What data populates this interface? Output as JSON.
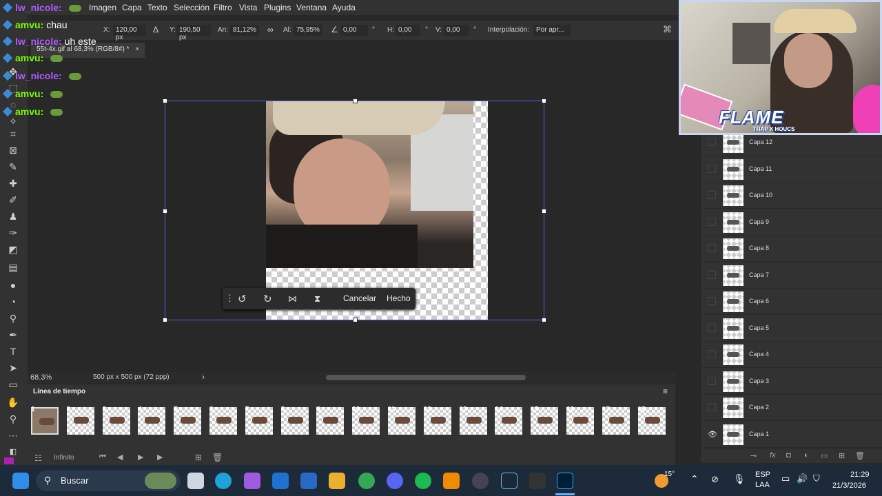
{
  "menu": {
    "items": [
      "Imagen",
      "Capa",
      "Texto",
      "Selección",
      "Filtro",
      "Vista",
      "Plugins",
      "Ventana",
      "Ayuda"
    ]
  },
  "options": {
    "x_label": "X:",
    "x_value": "120,00 px",
    "y_label": "Y:",
    "y_value": "190,50 px",
    "w_label": "An:",
    "w_value": "81,12%",
    "h_label": "Al:",
    "h_value": "75,95%",
    "angle_value": "0,00",
    "deg": "°",
    "hskew_label": "H:",
    "hskew_value": "0,00",
    "vskew_label": "V:",
    "vskew_value": "0,00",
    "interp_label": "Interpolación:",
    "interp_value": "Por apr..."
  },
  "document": {
    "tab_title": "55t-4x.gif al 68,3% (RGB/8#) *",
    "close": "×"
  },
  "context_bar": {
    "cancel": "Cancelar",
    "done": "Hecho"
  },
  "status": {
    "zoom": "68.3%",
    "doc_info": "500 px x 500 px (72 ppp)",
    "arrow": "›"
  },
  "timeline": {
    "title": "Línea de tiempo",
    "frames": [
      "1",
      "2",
      "3",
      "4",
      "5",
      "6",
      "7",
      "8",
      "9",
      "10",
      "11",
      "12",
      "13",
      "14",
      "15",
      "16",
      "17",
      "18"
    ],
    "loop": "Infinito"
  },
  "layers": {
    "items": [
      "Capa 12",
      "Capa 11",
      "Capa 10",
      "Capa 9",
      "Capa 8",
      "Capa 7",
      "Capa 6",
      "Capa 5",
      "Capa 4",
      "Capa 3",
      "Capa 2",
      "Capa 1"
    ]
  },
  "chat": {
    "messages": [
      {
        "user": "lw_nicole:",
        "text": "",
        "color": "#b05cff"
      },
      {
        "user": "amvu:",
        "text": "chau",
        "color": "#7cfc00"
      },
      {
        "user": "lw_nicole:",
        "text": "uh este",
        "color": "#b05cff"
      },
      {
        "user": "amvu:",
        "text": "",
        "color": "#7cfc00"
      },
      {
        "user": "lw_nicole:",
        "text": "",
        "color": "#b05cff"
      },
      {
        "user": "amvu:",
        "text": "",
        "color": "#7cfc00"
      },
      {
        "user": "amvu:",
        "text": "",
        "color": "#7cfc00"
      }
    ]
  },
  "overlay": {
    "brand": "FLAME",
    "sub": "TRAP X HOUCS"
  },
  "taskbar": {
    "search": "Buscar",
    "weather": "15°",
    "lang1": "ESP",
    "lang2": "LAA",
    "time": "21:29",
    "date": "21/3/2026"
  },
  "colors": {
    "accent_bbox": "#4a6bd8",
    "panel": "#323232"
  }
}
